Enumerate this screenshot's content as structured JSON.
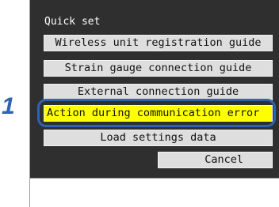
{
  "step_number": "1",
  "screen": {
    "title": "Quick set",
    "menu_items": [
      {
        "label": "Wireless unit registration guide"
      },
      {
        "label": "Strain gauge connection guide"
      },
      {
        "label": "External connection guide"
      },
      {
        "label": "Action during communication error",
        "selected": true
      },
      {
        "label": "Load settings data"
      }
    ],
    "cancel_label": "Cancel"
  },
  "colors": {
    "screen_background": "#2f2f2f",
    "button_background": "#dedede",
    "selected_background": "#ffff00",
    "highlight_ring": "#2e63b0",
    "step_number": "#2e63b0"
  }
}
